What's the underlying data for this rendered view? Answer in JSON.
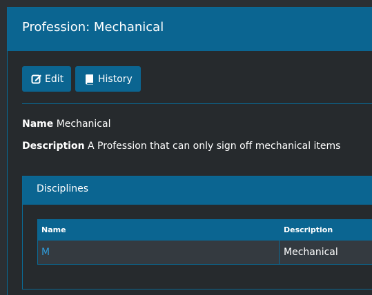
{
  "page": {
    "title": "Profession: Mechanical"
  },
  "toolbar": {
    "edit_label": "Edit",
    "history_label": "History"
  },
  "details": {
    "name_label": "Name",
    "name_value": "Mechanical",
    "description_label": "Description",
    "description_value": "A Profession that can only sign off mechanical items"
  },
  "disciplines": {
    "title": "Disciplines",
    "columns": [
      "Name",
      "Description"
    ],
    "rows": [
      {
        "name": "M",
        "description": "Mechanical"
      }
    ]
  },
  "colors": {
    "header_bg": "#0b6591",
    "page_bg": "#262a2d",
    "link": "#2f9ad9"
  },
  "icons": {
    "edit": "edit-icon",
    "history": "book-icon"
  }
}
